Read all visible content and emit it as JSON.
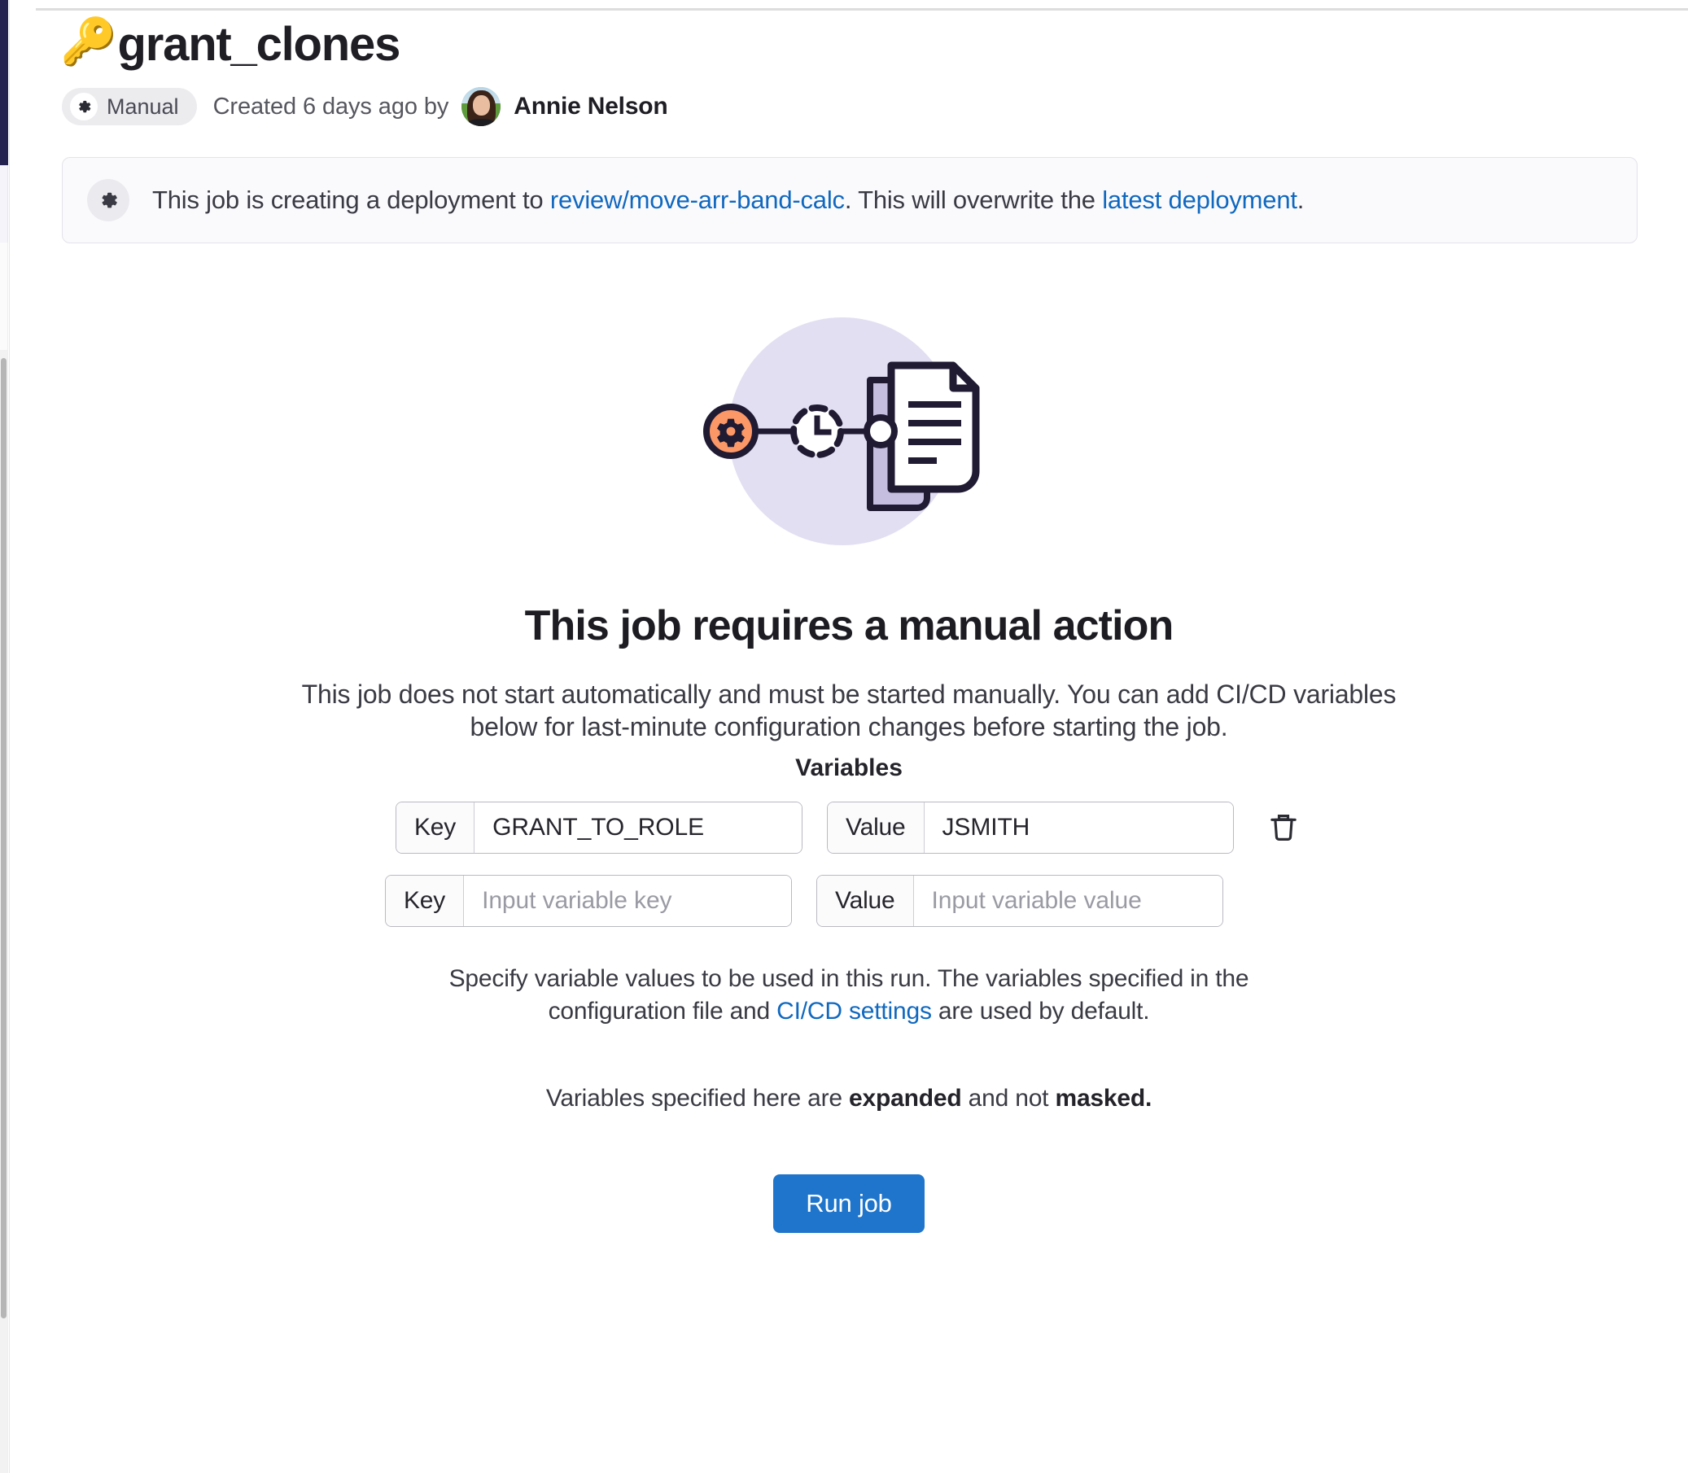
{
  "header": {
    "emoji": "🔑",
    "title": "grant_clones",
    "badge_label": "Manual",
    "badge_icon": "gear-icon",
    "created_text": "Created 6 days ago by",
    "author": "Annie Nelson"
  },
  "alert": {
    "icon": "gear-icon",
    "text_before": "This job is creating a deployment to",
    "environment_link": "review/move-arr-band-calc",
    "text_middle": ". This will overwrite the",
    "latest_link": "latest deployment",
    "text_end": "."
  },
  "empty_state": {
    "illustration": "manual-job-pipeline-illustration",
    "title": "This job requires a manual action",
    "description": "This job does not start automatically and must be started manually. You can add CI/CD variables below for last-minute configuration changes before starting the job.",
    "variables_label": "Variables"
  },
  "variables": {
    "key_addon": "Key",
    "value_addon": "Value",
    "rows": [
      {
        "key_value": "GRANT_TO_ROLE",
        "key_placeholder": "Input variable key",
        "value_value": "JSMITH",
        "value_placeholder": "Input variable value",
        "has_delete": true,
        "delete_icon": "trash-icon"
      },
      {
        "key_value": "",
        "key_placeholder": "Input variable key",
        "value_value": "",
        "value_placeholder": "Input variable value",
        "has_delete": false,
        "delete_icon": ""
      }
    ]
  },
  "helper": {
    "line1_before": "Specify variable values to be used in this run. The variables specified in the configuration file and",
    "settings_link": "CI/CD settings",
    "line1_after": "are used by default.",
    "line2_before": "Variables specified here are",
    "line2_bold1": "expanded",
    "line2_middle": "and not",
    "line2_bold2": "masked."
  },
  "actions": {
    "run_job_label": "Run job"
  },
  "colors": {
    "accent_blue": "#1f75cb",
    "link_blue": "#1068bf",
    "sidebar_navy": "#232150",
    "illustration_bg": "#e2dff2",
    "illustration_orange": "#fc9867",
    "illustration_purple": "#c6bede",
    "illustration_ink": "#201a33"
  }
}
